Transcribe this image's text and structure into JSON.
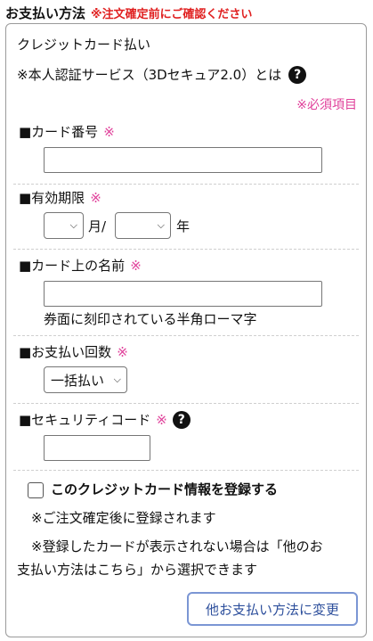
{
  "header": {
    "title": "お支払い方法",
    "warning": "※注文確定前にご確認ください"
  },
  "payment": {
    "method_title": "クレジットカード払い",
    "auth_text": "※本人認証サービス（3Dセキュア2.0）とは",
    "required_note": "※必須項目",
    "required_mark": "※"
  },
  "fields": {
    "card_number": {
      "label": "■カード番号",
      "value": ""
    },
    "expiry": {
      "label": "■有効期限",
      "month_value": "",
      "month_unit": "月/",
      "year_value": "",
      "year_unit": "年"
    },
    "card_name": {
      "label": "■カード上の名前",
      "value": "",
      "hint": "券面に刻印されている半角ローマ字"
    },
    "installments": {
      "label": "■お支払い回数",
      "selected": "一括払い"
    },
    "security_code": {
      "label": "■セキュリティコード",
      "value": ""
    }
  },
  "register": {
    "checkbox_label": "このクレジットカード情報を登録する",
    "checked": false,
    "note1": "※ご注文確定後に登録されます",
    "note2_line1": "※登録したカードが表示されない場合は「他のお",
    "note2_line2": "支払い方法はこちら」から選択できます"
  },
  "change_button": {
    "label": "他お支払い方法に変更"
  },
  "icons": {
    "help": "question-circle-icon",
    "dropdown": "chevron-down-icon"
  },
  "colors": {
    "warning": "#e02020",
    "required": "#e0409a",
    "button_border": "#7b96d4",
    "button_text": "#2d4f9c"
  }
}
